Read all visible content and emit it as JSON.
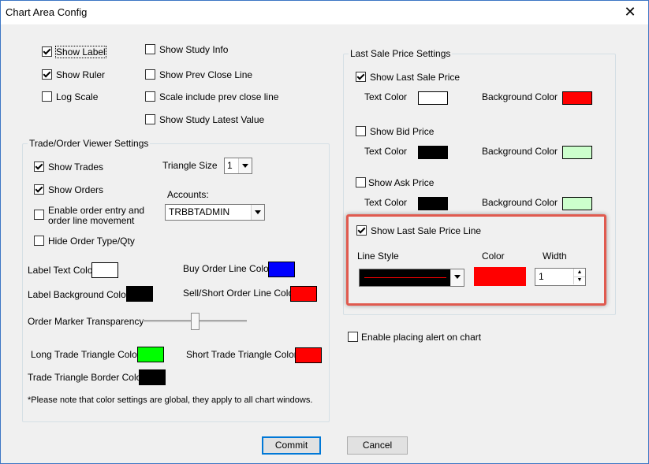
{
  "window": {
    "title": "Chart Area Config",
    "close_glyph": "✕"
  },
  "top_options": {
    "show_label": {
      "label": "Show Label",
      "checked": true
    },
    "show_ruler": {
      "label": "Show Ruler",
      "checked": true
    },
    "log_scale": {
      "label": "Log Scale",
      "checked": false
    },
    "show_study_info": {
      "label": "Show Study Info",
      "checked": false
    },
    "show_prev_close_line": {
      "label": "Show Prev Close Line",
      "checked": false
    },
    "scale_include_prev_close": {
      "label": "Scale include prev close line",
      "checked": false
    },
    "show_study_latest_value": {
      "label": "Show Study Latest Value",
      "checked": false
    }
  },
  "trade_viewer": {
    "title": "Trade/Order Viewer Settings",
    "show_trades": {
      "label": "Show Trades",
      "checked": true
    },
    "show_orders": {
      "label": "Show Orders",
      "checked": true
    },
    "enable_order_entry": {
      "label_line1": "Enable order entry and",
      "label_line2": "order line movement",
      "checked": false
    },
    "hide_order_type": {
      "label": "Hide Order Type/Qty",
      "checked": false
    },
    "triangle_size_label": "Triangle Size",
    "triangle_size_value": "1",
    "accounts_label": "Accounts:",
    "accounts_value": "TRBBTADMIN",
    "label_text_color": {
      "label": "Label Text Color",
      "color": "#ffffff"
    },
    "label_background_color": {
      "label": "Label Background Color",
      "color": "#000000"
    },
    "buy_order_line_color": {
      "label": "Buy Order Line Color",
      "color": "#0000ff"
    },
    "sell_short_order_line_color": {
      "label": "Sell/Short Order Line Color",
      "color": "#ff0000"
    },
    "order_marker_transparency": {
      "label": "Order Marker Transparency",
      "value_fraction": 0.5
    },
    "long_trade_triangle_color": {
      "label": "Long Trade Triangle Color",
      "color": "#00ff00"
    },
    "short_trade_triangle_color": {
      "label": "Short Trade Triangle Color",
      "color": "#ff0000"
    },
    "trade_triangle_border_color": {
      "label": "Trade Triangle Border Color",
      "color": "#000000"
    },
    "note": "*Please note that color settings are global, they apply to all chart windows."
  },
  "last_sale": {
    "title": "Last Sale Price Settings",
    "show_last_sale_price": {
      "label": "Show Last Sale Price",
      "checked": true
    },
    "show_bid_price": {
      "label": "Show Bid Price",
      "checked": false
    },
    "show_ask_price": {
      "label": "Show Ask Price",
      "checked": false
    },
    "text_color_label": "Text Color",
    "background_color_label": "Background Color",
    "last_text_color": "#ffffff",
    "last_bg_color": "#ff0000",
    "bid_text_color": "#000000",
    "bid_bg_color": "#ccffcc",
    "ask_text_color": "#000000",
    "ask_bg_color": "#ccffcc",
    "show_last_sale_price_line": {
      "label": "Show Last Sale Price Line",
      "checked": true
    },
    "line_style_label": "Line Style",
    "color_label": "Color",
    "width_label": "Width",
    "line_color": "#ff0000",
    "width_value": "1"
  },
  "enable_alert": {
    "label": "Enable placing alert on chart",
    "checked": false
  },
  "buttons": {
    "commit": "Commit",
    "cancel": "Cancel"
  },
  "colors": {
    "highlight": "#e05a4f"
  }
}
